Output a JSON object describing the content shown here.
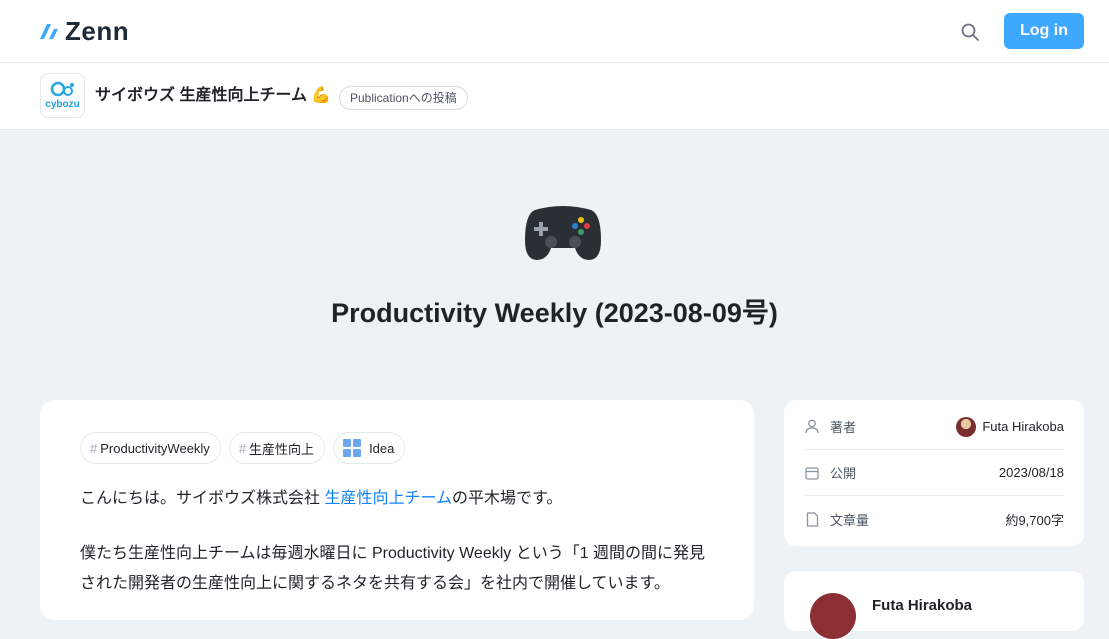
{
  "header": {
    "logo_text": "Zenn",
    "login_label": "Log in",
    "search_icon": "search-icon"
  },
  "publication": {
    "logo_text": "cybozu",
    "name": "サイボウズ 生産性向上チーム 💪",
    "badge": "Publicationへの投稿"
  },
  "article": {
    "emoji": "🎮",
    "title": "Productivity Weekly (2023-08-09号)",
    "topics": [
      {
        "label": "ProductivityWeekly",
        "icon": "hash-icon"
      },
      {
        "label": "生産性向上",
        "icon": "hash-icon"
      },
      {
        "label": "Idea",
        "icon": "idea-icon"
      }
    ],
    "paragraph1": {
      "before": "こんにちは。サイボウズ株式会社 ",
      "link": "生産性向上チーム",
      "after": "の平木場です。"
    },
    "paragraph2": "僕たち生産性向上チームは毎週水曜日に Productivity Weekly という「1 週間の間に発見された開発者の生産性向上に関するネタを共有する会」を社内で開催しています。"
  },
  "info": {
    "author_label": "著者",
    "author_name": "Futa Hirakoba",
    "published_label": "公開",
    "published_date": "2023/08/18",
    "length_label": "文章量",
    "length_value": "約9,700字"
  },
  "author_card": {
    "name": "Futa Hirakoba"
  }
}
